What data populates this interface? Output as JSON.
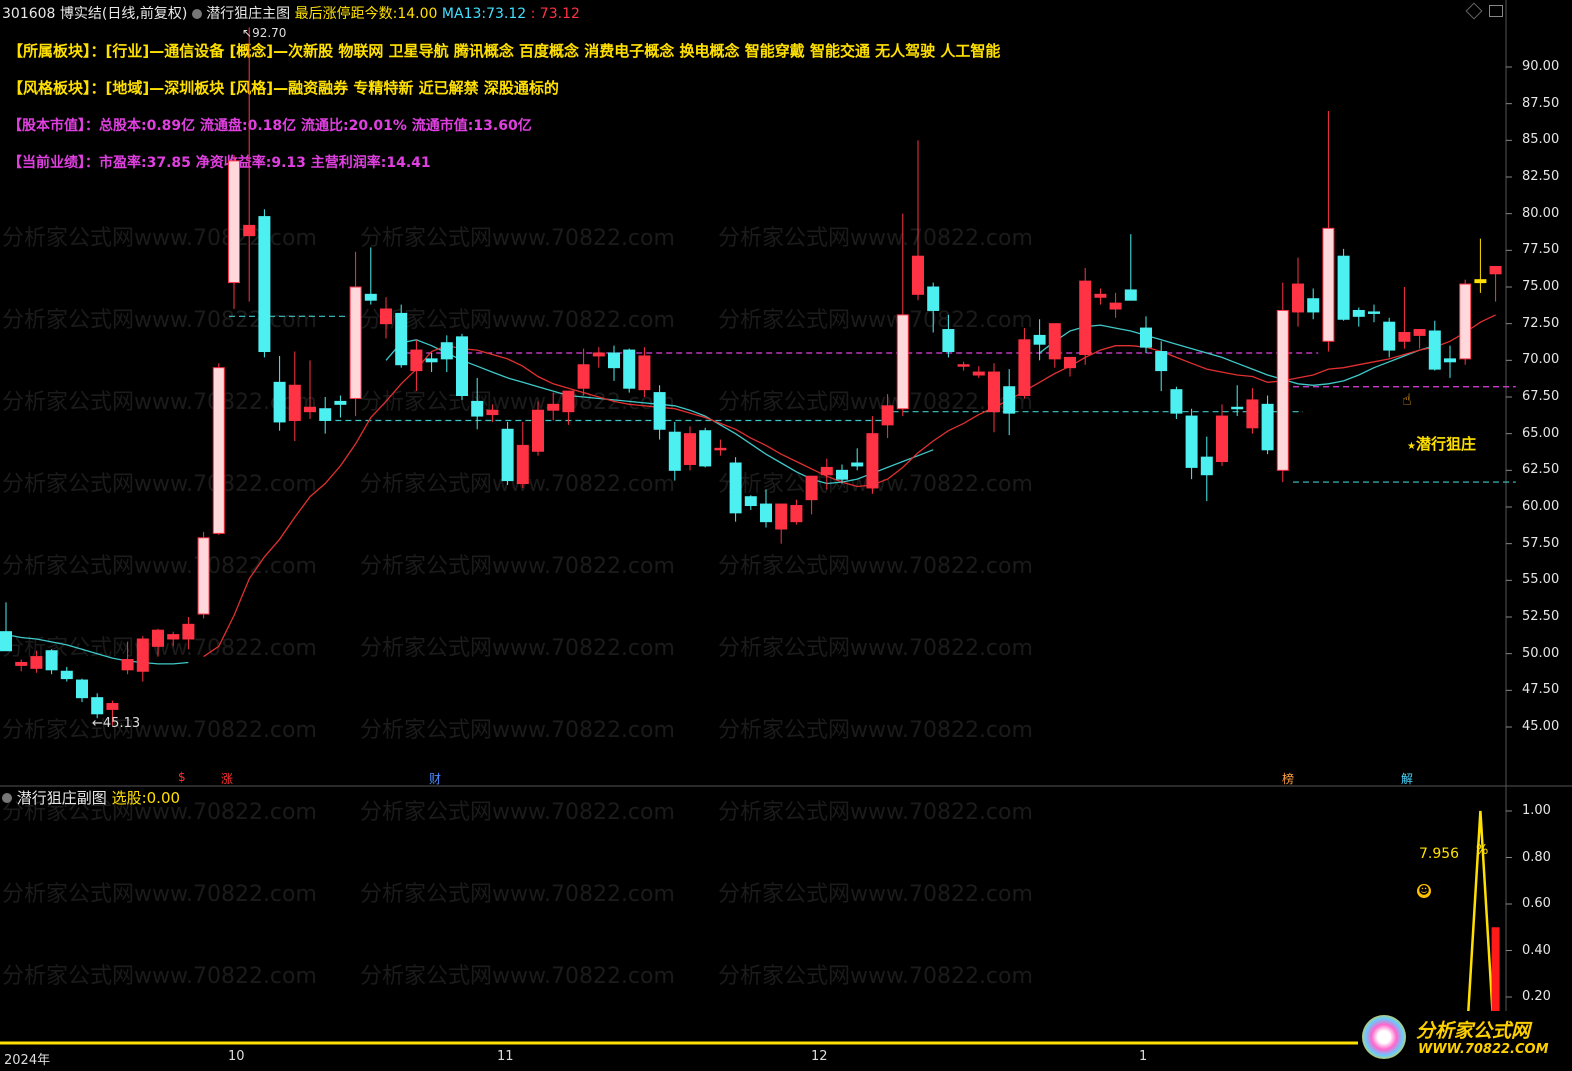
{
  "header": {
    "code": "301608",
    "name": "博实结",
    "period": "(日线,前复权)",
    "indicator": "潜行狙庄主图",
    "limit_label": "最后涨停距今数:",
    "limit_value": "14.00",
    "ma_label": "MA13:",
    "ma_value": "73.12",
    "ma_value2": ": 73.12"
  },
  "info": {
    "row1_label": "【所属板块】：",
    "row1_text": "[行业]—通信设备 [概念]—次新股 物联网 卫星导航 腾讯概念 百度概念 消费电子概念 换电概念 智能穿戴 智能交通 无人驾驶 人工智能",
    "row2_label": "【风格板块】：",
    "row2_text": "[地域]—深圳板块 [风格]—融资融券 专精特新 近已解禁 深股通标的",
    "row3_label": "【股本市值】：",
    "row3_text": "总股本:0.89亿 流通盘:0.18亿 流通比:20.01% 流通市值:13.60亿",
    "row4_label": "【当前业绩】：",
    "row4_text": "市盈率:37.85 净资收益率:9.13 主营利润率:14.41"
  },
  "annotations": {
    "high": "92.70",
    "low": "45.13",
    "signal": "潜行狙庄"
  },
  "markers": [
    {
      "text": "$",
      "color": "#ff3030"
    },
    {
      "text": "涨",
      "color": "#ff3030"
    },
    {
      "text": "财",
      "color": "#4a8cff"
    },
    {
      "text": "榜",
      "color": "#ffa040"
    },
    {
      "text": "解",
      "color": "#4ad7ff"
    }
  ],
  "main_axis": [
    "90.00",
    "87.50",
    "85.00",
    "82.50",
    "80.00",
    "77.50",
    "75.00",
    "72.50",
    "70.00",
    "67.50",
    "65.00",
    "62.50",
    "60.00",
    "57.50",
    "55.00",
    "52.50",
    "50.00",
    "47.50",
    "45.00"
  ],
  "sub": {
    "title": "潜行狙庄副图",
    "select_label": "选股:",
    "select_value": "0.00",
    "value": "7.956",
    "unit": "%",
    "axis": [
      "1.00",
      "0.80",
      "0.60",
      "0.40",
      "0.20"
    ]
  },
  "time_axis": [
    "2024年",
    "10",
    "11",
    "12",
    "1"
  ],
  "watermark": "分析家公式网www.70822.com",
  "logo": {
    "line1": "分析家公式网",
    "line2": "WWW.70822.COM"
  },
  "colors": {
    "up": "#ff3344",
    "down": "#4df0f0",
    "ma13": "#e03030",
    "ma_slow": "#40c8c8",
    "magenta": "#e040e0",
    "yellow": "#ffe000"
  },
  "chart_data": {
    "type": "candlestick",
    "ylim": [
      43,
      93
    ],
    "candles": [
      [
        51.5,
        53.5,
        50.8,
        50.2
      ],
      [
        49.2,
        49.6,
        48.8,
        49.4
      ],
      [
        49.0,
        50.2,
        48.7,
        49.8
      ],
      [
        50.2,
        50.3,
        48.6,
        48.9
      ],
      [
        48.8,
        49.1,
        48.1,
        48.3
      ],
      [
        48.2,
        48.3,
        46.7,
        47.0
      ],
      [
        47.0,
        47.3,
        45.6,
        45.9
      ],
      [
        46.2,
        46.8,
        45.13,
        46.6
      ],
      [
        48.9,
        50.8,
        48.6,
        49.6
      ],
      [
        48.8,
        51.2,
        48.1,
        51.0
      ],
      [
        50.5,
        51.7,
        49.8,
        51.6
      ],
      [
        51.0,
        51.5,
        50.5,
        51.3
      ],
      [
        51.0,
        52.5,
        50.3,
        52.0
      ],
      [
        52.7,
        58.3,
        52.4,
        57.9
      ],
      [
        58.2,
        69.8,
        58.1,
        69.5
      ],
      [
        75.3,
        84.0,
        73.5,
        83.6
      ],
      [
        78.5,
        92.7,
        74.0,
        79.2
      ],
      [
        79.8,
        80.3,
        70.2,
        70.6
      ],
      [
        68.5,
        70.3,
        65.2,
        65.8
      ],
      [
        65.9,
        70.6,
        64.5,
        68.3
      ],
      [
        66.5,
        70.0,
        66.0,
        66.8
      ],
      [
        66.7,
        67.5,
        65.0,
        65.9
      ],
      [
        67.2,
        67.6,
        66.1,
        67.0
      ],
      [
        67.4,
        77.4,
        66.2,
        75.0
      ],
      [
        74.5,
        77.7,
        73.8,
        74.1
      ],
      [
        72.5,
        74.3,
        71.5,
        73.5
      ],
      [
        73.2,
        73.8,
        69.5,
        69.7
      ],
      [
        69.3,
        71.4,
        67.9,
        70.7
      ],
      [
        70.1,
        70.5,
        69.2,
        69.9
      ],
      [
        71.2,
        71.7,
        69.2,
        70.1
      ],
      [
        71.6,
        71.8,
        67.3,
        67.6
      ],
      [
        67.2,
        68.8,
        65.3,
        66.2
      ],
      [
        66.3,
        67.0,
        65.8,
        66.6
      ],
      [
        65.3,
        65.8,
        61.5,
        61.8
      ],
      [
        61.6,
        65.8,
        61.3,
        64.2
      ],
      [
        63.8,
        67.2,
        63.5,
        66.6
      ],
      [
        66.6,
        67.8,
        65.9,
        67.0
      ],
      [
        66.5,
        67.5,
        65.6,
        67.9
      ],
      [
        68.1,
        70.8,
        67.6,
        69.7
      ],
      [
        70.3,
        70.9,
        69.5,
        70.5
      ],
      [
        70.5,
        71.0,
        68.6,
        69.5
      ],
      [
        70.7,
        70.8,
        67.8,
        68.1
      ],
      [
        68.0,
        70.9,
        67.5,
        70.3
      ],
      [
        67.8,
        68.3,
        64.6,
        65.3
      ],
      [
        65.1,
        65.8,
        61.8,
        62.5
      ],
      [
        62.9,
        65.5,
        62.5,
        65.0
      ],
      [
        65.2,
        65.4,
        62.7,
        62.8
      ],
      [
        63.9,
        64.6,
        63.5,
        64.0
      ],
      [
        63.0,
        63.4,
        59.0,
        59.6
      ],
      [
        60.7,
        60.8,
        59.8,
        60.1
      ],
      [
        60.2,
        61.2,
        58.6,
        59.0
      ],
      [
        58.5,
        60.1,
        57.5,
        60.2
      ],
      [
        59.0,
        60.5,
        58.8,
        60.1
      ],
      [
        60.5,
        61.8,
        59.5,
        62.1
      ],
      [
        62.2,
        63.3,
        61.2,
        62.7
      ],
      [
        62.5,
        62.9,
        61.6,
        61.9
      ],
      [
        63.0,
        64.0,
        62.5,
        62.8
      ],
      [
        61.3,
        66.2,
        60.9,
        65.0
      ],
      [
        65.6,
        67.7,
        64.7,
        66.9
      ],
      [
        66.7,
        80.0,
        66.2,
        73.1
      ],
      [
        74.5,
        85.0,
        74.1,
        77.1
      ],
      [
        75.0,
        75.3,
        71.9,
        73.4
      ],
      [
        72.1,
        73.1,
        70.2,
        70.6
      ],
      [
        69.6,
        69.9,
        69.3,
        69.7
      ],
      [
        69.0,
        69.6,
        68.8,
        69.2
      ],
      [
        66.5,
        69.8,
        65.1,
        69.2
      ],
      [
        68.2,
        69.4,
        64.9,
        66.4
      ],
      [
        67.6,
        72.2,
        67.4,
        71.4
      ],
      [
        71.7,
        72.8,
        70.0,
        71.1
      ],
      [
        70.1,
        72.2,
        69.5,
        72.5
      ],
      [
        69.5,
        70.2,
        68.9,
        70.2
      ],
      [
        70.4,
        76.3,
        69.7,
        75.4
      ],
      [
        74.3,
        74.9,
        73.8,
        74.5
      ],
      [
        73.5,
        74.6,
        72.9,
        73.9
      ],
      [
        74.8,
        78.6,
        74.3,
        74.1
      ],
      [
        72.2,
        73.0,
        70.5,
        70.9
      ],
      [
        70.6,
        71.3,
        67.9,
        69.3
      ],
      [
        68.0,
        68.2,
        66.0,
        66.4
      ],
      [
        66.2,
        66.7,
        61.9,
        62.7
      ],
      [
        63.4,
        64.8,
        60.4,
        62.2
      ],
      [
        63.1,
        67.0,
        62.8,
        66.2
      ],
      [
        66.8,
        68.3,
        66.2,
        66.7
      ],
      [
        65.4,
        68.1,
        65.0,
        67.3
      ],
      [
        67.0,
        67.6,
        63.6,
        63.9
      ],
      [
        62.5,
        75.3,
        61.7,
        73.4
      ],
      [
        73.3,
        77.0,
        72.3,
        75.2
      ],
      [
        74.2,
        74.9,
        72.8,
        73.3
      ],
      [
        71.3,
        87.0,
        70.6,
        79.0
      ],
      [
        77.1,
        77.6,
        72.7,
        72.8
      ],
      [
        73.4,
        73.6,
        72.3,
        73.0
      ],
      [
        73.3,
        73.8,
        72.6,
        73.2
      ],
      [
        72.6,
        72.9,
        70.2,
        70.7
      ],
      [
        71.3,
        75.0,
        70.8,
        71.9
      ],
      [
        71.7,
        72.1,
        70.8,
        72.1
      ],
      [
        72.0,
        72.7,
        69.3,
        69.4
      ],
      [
        70.1,
        71.0,
        68.8,
        69.9
      ],
      [
        70.1,
        75.5,
        69.7,
        75.2
      ],
      [
        75.5,
        78.3,
        74.6,
        75.3
      ],
      [
        75.9,
        76.4,
        74.0,
        76.4
      ]
    ],
    "ma13": [
      null,
      null,
      null,
      null,
      null,
      null,
      null,
      null,
      null,
      null,
      null,
      null,
      null,
      49.8,
      50.5,
      52.6,
      55.1,
      56.6,
      57.8,
      59.3,
      60.7,
      61.6,
      62.8,
      64.3,
      66.1,
      67.2,
      68.4,
      69.4,
      70.6,
      71.0,
      70.8,
      70.7,
      70.4,
      70.1,
      69.6,
      68.9,
      68.4,
      68.1,
      67.8,
      67.5,
      67.2,
      67.0,
      66.9,
      66.8,
      66.7,
      66.4,
      66.1,
      65.7,
      65.3,
      64.7,
      64.2,
      63.6,
      63.1,
      62.6,
      62.1,
      61.7,
      61.4,
      61.5,
      61.9,
      62.7,
      63.7,
      64.5,
      65.2,
      65.7,
      66.3,
      66.8,
      67.3,
      67.9,
      68.5,
      69.1,
      69.6,
      70.2,
      70.7,
      71.0,
      71.0,
      70.9,
      70.6,
      70.2,
      69.8,
      69.4,
      69.2,
      69.0,
      68.9,
      68.5,
      68.6,
      68.8,
      69.0,
      69.4,
      69.5,
      69.7,
      69.9,
      70.1,
      70.4,
      70.7,
      70.9,
      71.3,
      71.9,
      72.6,
      73.1
    ],
    "ma_slow": [
      51.3,
      51.1,
      51.0,
      50.8,
      50.6,
      50.3,
      50.0,
      49.7,
      49.5,
      49.4,
      49.3,
      49.3,
      49.4,
      null,
      null,
      null,
      null,
      null,
      null,
      null,
      null,
      null,
      null,
      null,
      null,
      70.0,
      71.2,
      71.4,
      71.0,
      70.5,
      70.0,
      69.6,
      69.2,
      68.8,
      68.5,
      68.2,
      67.9,
      67.6,
      67.5,
      67.4,
      67.3,
      67.2,
      67.1,
      67.0,
      66.9,
      66.6,
      66.2,
      65.6,
      65.0,
      64.3,
      63.6,
      63.0,
      62.4,
      61.9,
      61.6,
      61.7,
      61.9,
      62.3,
      62.7,
      63.1,
      63.5,
      63.9,
      null,
      null,
      null,
      null,
      null,
      null,
      70.5,
      71.3,
      72.0,
      72.3,
      72.4,
      72.2,
      72.0,
      71.7,
      71.4,
      71.1,
      70.8,
      70.5,
      70.2,
      69.8,
      69.4,
      69.0,
      68.7,
      68.4,
      68.3,
      68.4,
      68.6,
      69.0,
      69.5,
      69.9,
      70.3,
      70.7,
      71.0,
      null,
      null,
      null,
      null
    ],
    "levels": [
      {
        "name": "cyan-level-1",
        "value": 73.0,
        "from": 15,
        "to": 22
      },
      {
        "name": "cyan-level-2",
        "value": 65.9,
        "from": 22,
        "to": 58
      },
      {
        "name": "magenta-level-1",
        "value": 70.5,
        "from": 26,
        "to": 86
      },
      {
        "name": "cyan-level-3",
        "value": 66.5,
        "from": 58,
        "to": 85
      },
      {
        "name": "cyan-level-4",
        "value": 61.7,
        "from": 85,
        "to": 99
      },
      {
        "name": "magenta-level-2",
        "value": 68.2,
        "from": 85,
        "to": 99
      }
    ],
    "sub_line": {
      "peak_index": 97,
      "peak_value": 1.0,
      "bar_index": 98,
      "bar_value": 0.5,
      "ylim": [
        0,
        1.1
      ]
    }
  }
}
